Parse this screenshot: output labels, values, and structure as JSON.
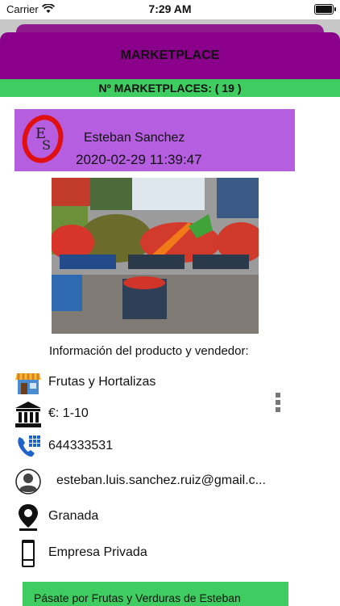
{
  "status_bar": {
    "carrier": "Carrier",
    "time": "7:29 AM"
  },
  "header": {
    "title": "MARKETPLACE"
  },
  "counter": {
    "text": "Nº MARKETPLACES: ( 19 )"
  },
  "seller": {
    "name": "Esteban Sanchez",
    "date": "2020-02-29 11:39:47",
    "logo_text": "ES"
  },
  "info": {
    "title": "Información del producto y vendedor:",
    "category": "Frutas y Hortalizas",
    "price": "€: 1-10",
    "phone": "644333531",
    "email": "esteban.luis.sanchez.ruiz@gmail.c...",
    "city": "Granada",
    "company_type": "Empresa Privada"
  },
  "footer": {
    "text": "Pásate por Frutas y Verduras de Esteban"
  },
  "colors": {
    "header": "#8a008a",
    "counter": "#3fcc60",
    "seller_card": "#b55ee0"
  }
}
